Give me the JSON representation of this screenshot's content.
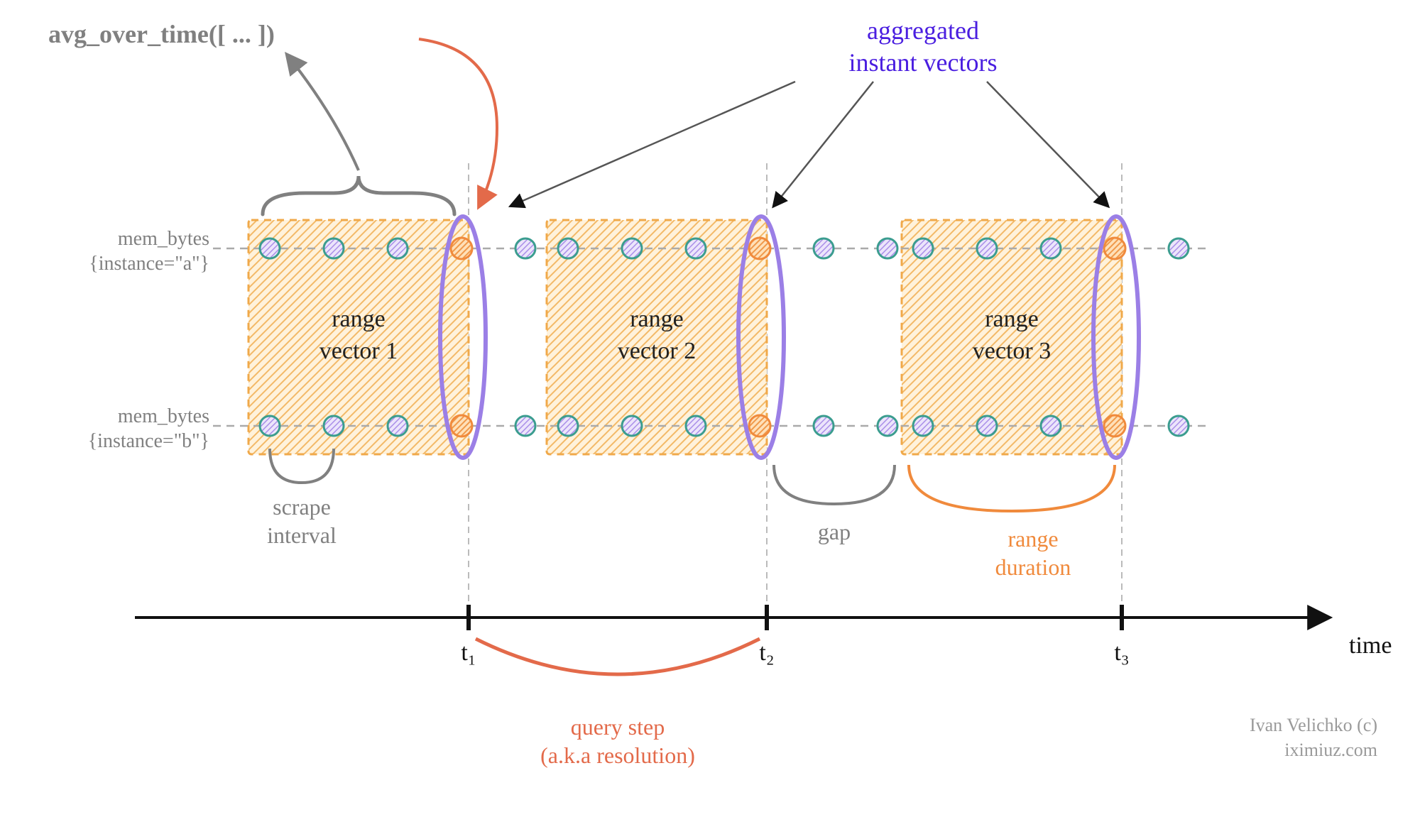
{
  "title": "avg_over_time([ ... ])",
  "aggregated_label_l1": "aggregated",
  "aggregated_label_l2": "instant vectors",
  "series": [
    {
      "name_l1": "mem_bytes",
      "name_l2": "{instance=\"a\"}"
    },
    {
      "name_l1": "mem_bytes",
      "name_l2": "{instance=\"b\"}"
    }
  ],
  "ranges": [
    {
      "label_l1": "range",
      "label_l2": "vector 1"
    },
    {
      "label_l1": "range",
      "label_l2": "vector 2"
    },
    {
      "label_l1": "range",
      "label_l2": "vector 3"
    }
  ],
  "annotations": {
    "scrape_l1": "scrape",
    "scrape_l2": "interval",
    "gap": "gap",
    "range_dur_l1": "range",
    "range_dur_l2": "duration",
    "query_l1": "query step",
    "query_l2": "(a.k.a resolution)"
  },
  "time_ticks": {
    "t1": "t₁",
    "t2": "t₂",
    "t3": "t₃"
  },
  "axis_label": "time",
  "credit_l1": "Ivan Velichko (c)",
  "credit_l2": "iximiuz.com",
  "colors": {
    "orange_fill": "#fbcf82",
    "orange_stroke": "#f08a3c",
    "purple": "#9b7fe6",
    "red": "#e36a4a",
    "gray": "#808080",
    "teal": "#3b9d8f",
    "dot_fill": "#b9a9e8"
  }
}
